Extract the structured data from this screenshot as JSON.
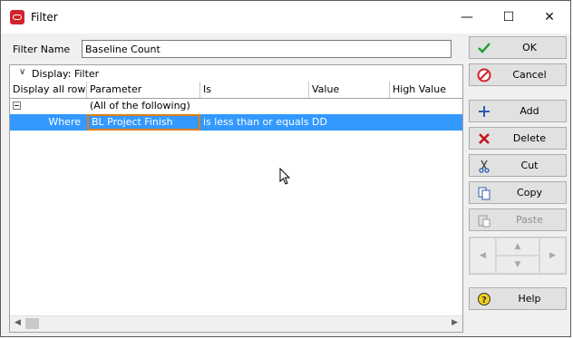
{
  "window": {
    "title": "Filter",
    "controls": {
      "minimize": "—",
      "maximize": "☐",
      "close": "✕"
    }
  },
  "filter_name": {
    "label": "Filter Name",
    "value": "Baseline Count"
  },
  "grid": {
    "group_label": "Display: Filter",
    "columns": [
      "Display all rows",
      "Parameter",
      "Is",
      "Value",
      "High Value"
    ],
    "rows": [
      {
        "display": "",
        "parameter": "(All of the following)",
        "is": "",
        "value": "",
        "high": ""
      },
      {
        "display": "Where",
        "parameter": "BL Project Finish",
        "is": "is less than or equals",
        "value": "DD",
        "high": ""
      }
    ]
  },
  "buttons": {
    "ok": "OK",
    "cancel": "Cancel",
    "add": "Add",
    "delete": "Delete",
    "cut": "Cut",
    "copy": "Copy",
    "paste": "Paste",
    "help": "Help"
  },
  "icons": {
    "app": "oracle-icon",
    "ok": "check-icon",
    "cancel": "no-entry-icon",
    "add": "plus-icon",
    "delete": "x-icon",
    "cut": "scissors-icon",
    "copy": "copy-icon",
    "paste": "paste-icon",
    "help": "help-icon"
  },
  "colors": {
    "selection": "#3399ff",
    "focus_border": "#e07b14",
    "brand": "#d2232a"
  }
}
